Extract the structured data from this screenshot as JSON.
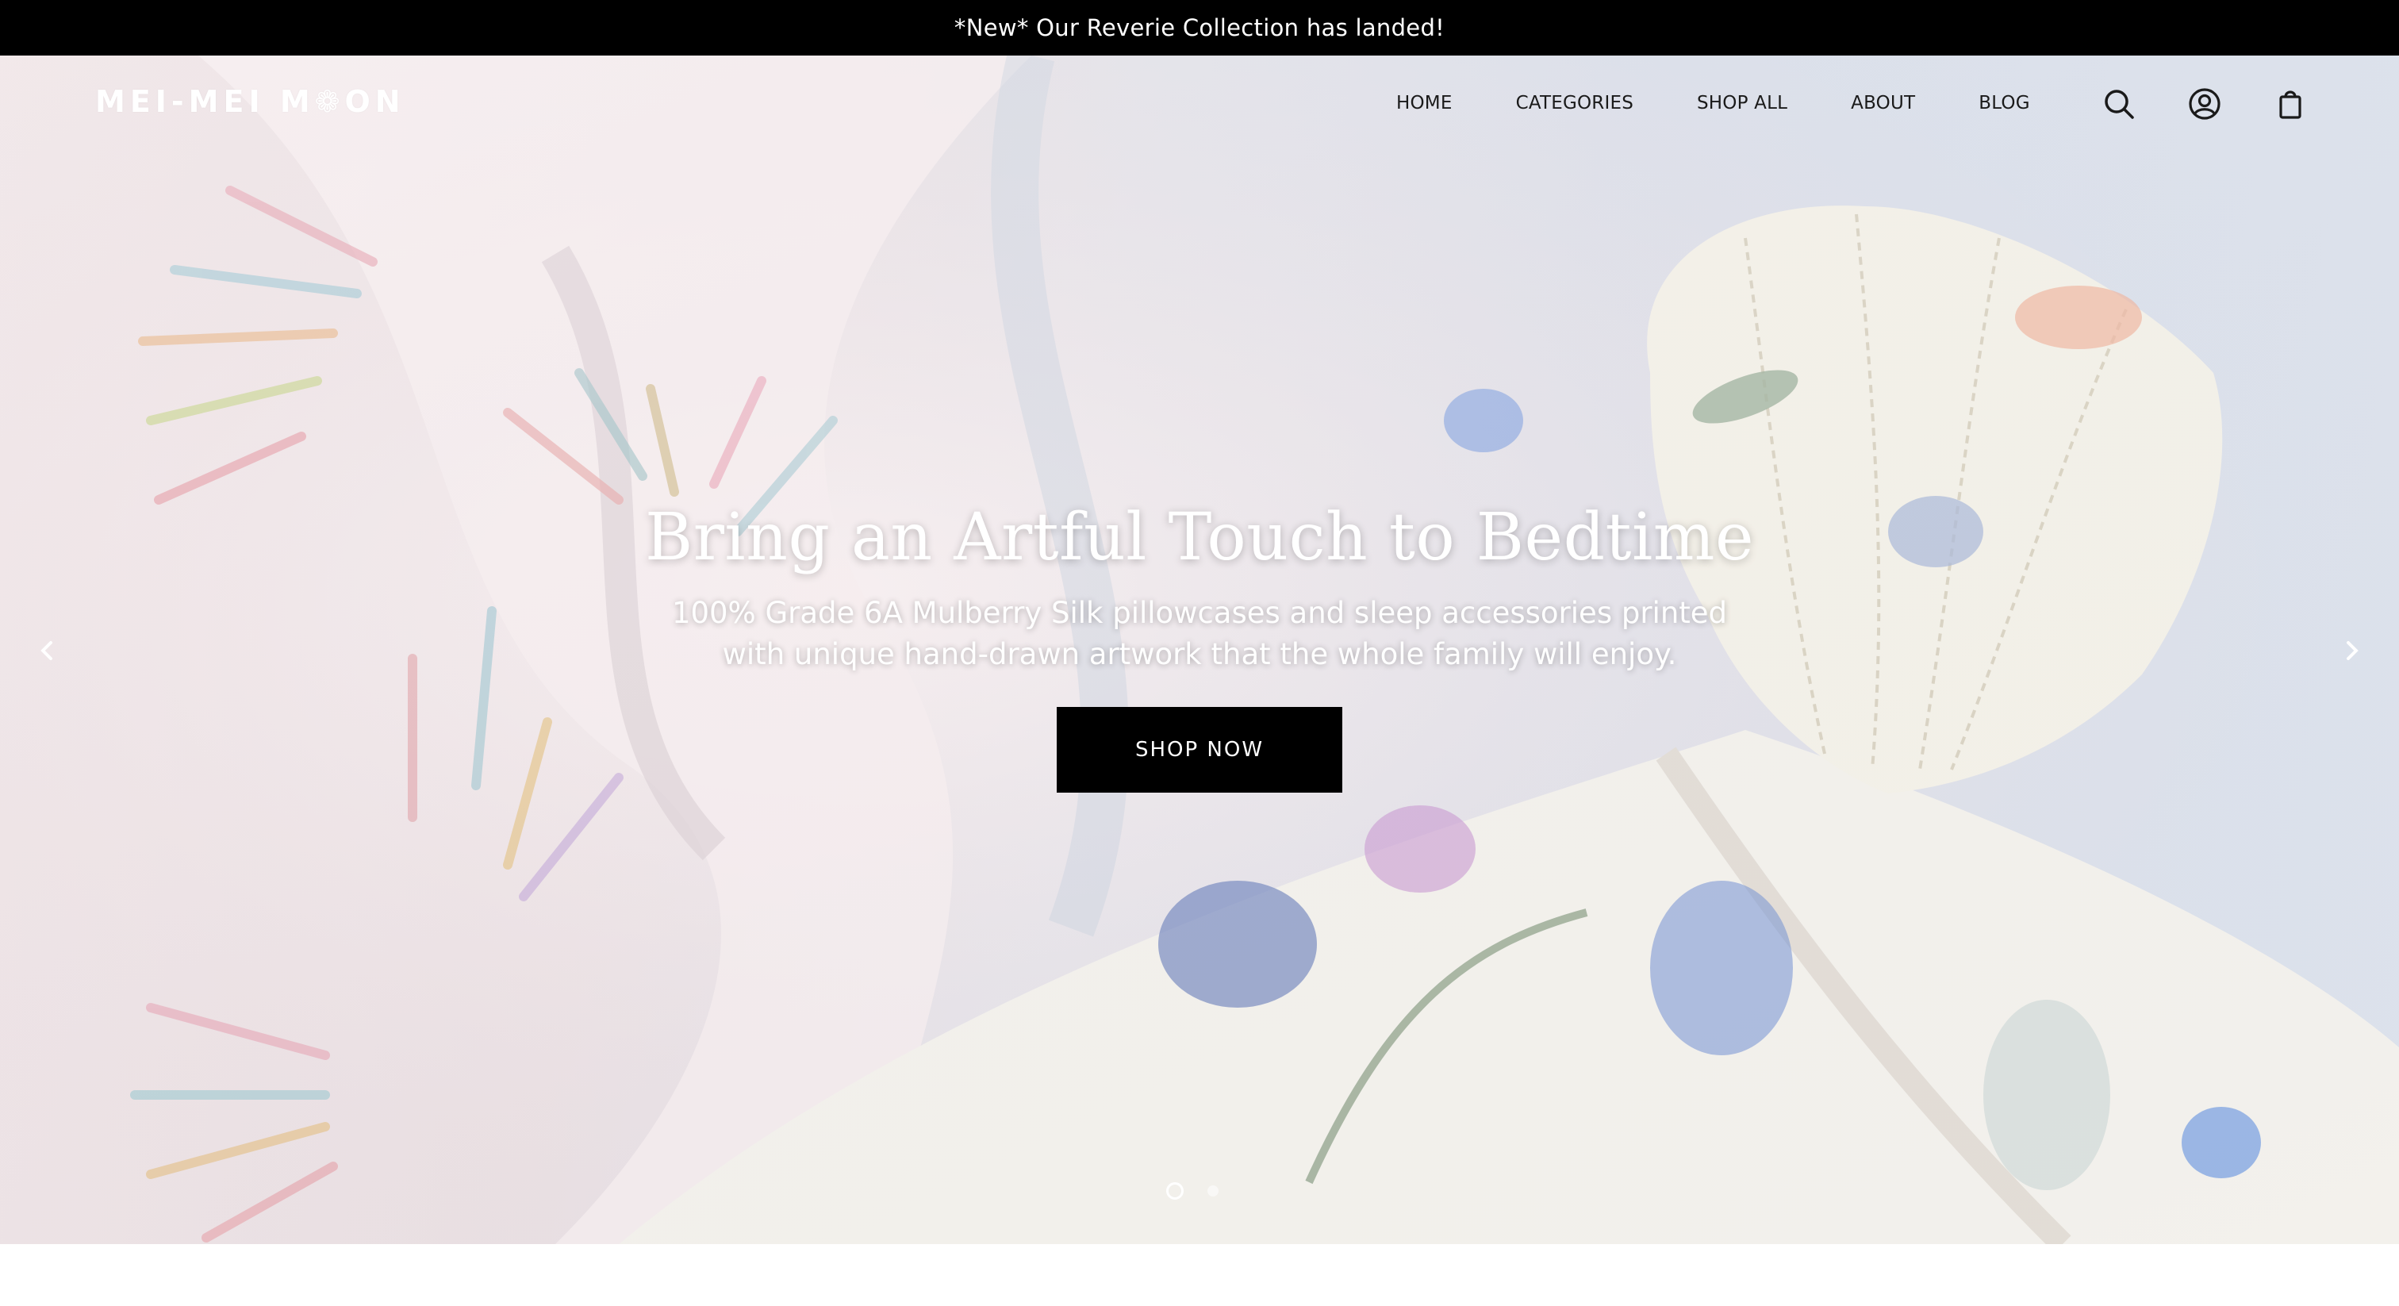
{
  "announcement": {
    "text": "*New* Our Reverie Collection has landed!"
  },
  "header": {
    "logo": "MEI-MEI M❁ON",
    "nav": [
      {
        "label": "HOME"
      },
      {
        "label": "CATEGORIES"
      },
      {
        "label": "SHOP ALL"
      },
      {
        "label": "ABOUT"
      },
      {
        "label": "BLOG"
      }
    ],
    "icons": [
      "search-icon",
      "account-icon",
      "cart-icon"
    ]
  },
  "hero": {
    "title": "Bring an Artful Touch to Bedtime",
    "subtitle": "100% Grade 6A Mulberry Silk pillowcases and sleep accessories printed with unique hand-drawn artwork that the whole family will enjoy.",
    "button_label": "SHOP NOW",
    "slides_total": 2,
    "active_slide": 1
  },
  "colors": {
    "announcement_bg": "#000000",
    "button_bg": "#000000",
    "text_light": "#ffffff",
    "nav_text": "#1a1a1a"
  }
}
